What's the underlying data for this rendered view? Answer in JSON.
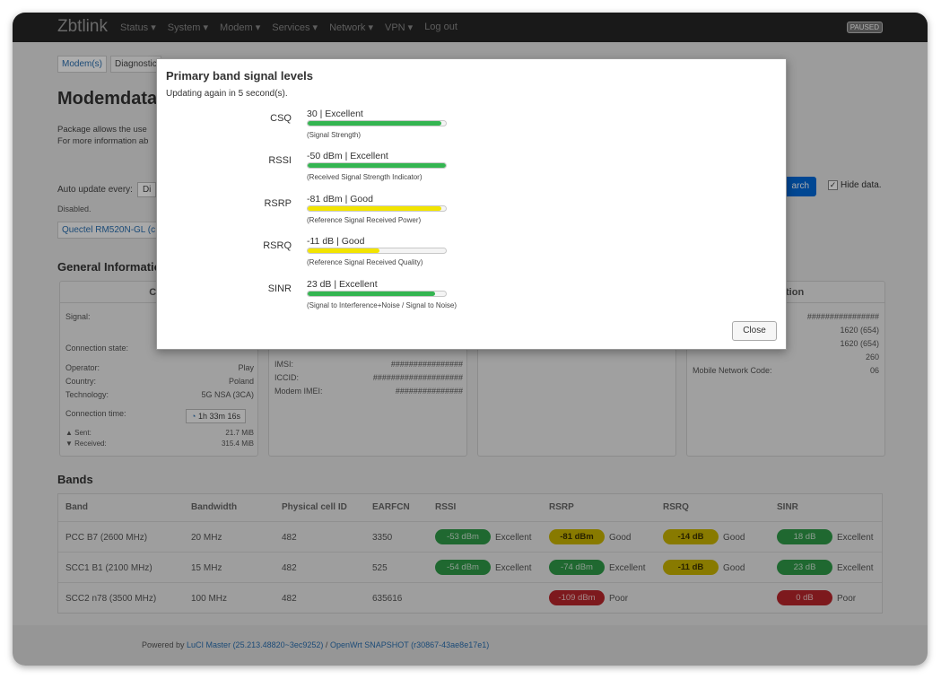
{
  "navbar": {
    "brand": "Zbtlink",
    "menu": [
      "Status ▾",
      "System ▾",
      "Modem ▾",
      "Services ▾",
      "Network ▾",
      "VPN ▾",
      "Log out"
    ],
    "badge": "PAUSED"
  },
  "page": {
    "tabs": [
      "Modem(s)",
      "Diagnostic"
    ],
    "title": "Modemdata",
    "desc_1": "Package allows the use",
    "desc_2": "For more information ab",
    "auto_update_label": "Auto update every:",
    "auto_update_value": "Di",
    "disabled": "Disabled.",
    "search_button": "arch",
    "hide_data": "Hide data.",
    "modem_tab": "Quectel RM520N-GL (c",
    "general_title": "General Informatio"
  },
  "cards": {
    "conn_header": "Con",
    "info_header": "rmation",
    "conn": {
      "signal_label": "Signal:",
      "state_label": "Connection state:",
      "operator_label": "Operator:",
      "operator": "Play",
      "country_label": "Country:",
      "country": "Poland",
      "tech_label": "Technology:",
      "tech": "5G NSA (3CA)",
      "time_label": "Connection time:",
      "time": "1h 33m 16s",
      "sent_label": "▲ Sent:",
      "sent": "21.7 MiB",
      "recv_label": "▼ Received:",
      "recv": "315.4 MiB"
    },
    "sim": {
      "imsi_label": "IMSI:",
      "imsi": "################",
      "iccid_label": "ICCID:",
      "iccid": "####################",
      "imei_label": "Modem IMEI:",
      "imei": "###############"
    },
    "cell": {
      "v1": "################",
      "v2": "1620 (654)",
      "v3": "1620 (654)",
      "v4": "260",
      "mnc_label": "Mobile Network Code:",
      "mnc": "06"
    }
  },
  "bands": {
    "title": "Bands",
    "headers": [
      "Band",
      "Bandwidth",
      "Physical cell ID",
      "EARFCN",
      "RSSI",
      "RSRP",
      "RSRQ",
      "SINR"
    ],
    "rows": [
      {
        "band": "PCC B7 (2600 MHz)",
        "bw": "20 MHz",
        "pci": "482",
        "earfcn": "3350",
        "rssi": "-53 dBm",
        "rssi_q": "Excellent",
        "rsrp": "-81 dBm",
        "rsrp_q": "Good",
        "rsrq": "-14 dB",
        "rsrq_q": "Good",
        "sinr": "18 dB",
        "sinr_q": "Excellent"
      },
      {
        "band": "SCC1 B1 (2100 MHz)",
        "bw": "15 MHz",
        "pci": "482",
        "earfcn": "525",
        "rssi": "-54 dBm",
        "rssi_q": "Excellent",
        "rsrp": "-74 dBm",
        "rsrp_q": "Excellent",
        "rsrq": "-11 dB",
        "rsrq_q": "Good",
        "sinr": "23 dB",
        "sinr_q": "Excellent"
      },
      {
        "band": "SCC2 n78 (3500 MHz)",
        "bw": "100 MHz",
        "pci": "482",
        "earfcn": "635616",
        "rssi": "",
        "rssi_q": "",
        "rsrp": "-109 dBm",
        "rsrp_q": "Poor",
        "rsrq": "",
        "rsrq_q": "",
        "sinr": "0 dB",
        "sinr_q": "Poor"
      }
    ]
  },
  "footer": {
    "prefix": "Powered by",
    "luci": "LuCI Master (25.213.48820~3ec9252)",
    "sep": "/",
    "openwrt": "OpenWrt SNAPSHOT (r30867-43ae8e17e1)"
  },
  "modal": {
    "title": "Primary band signal levels",
    "updating": "Updating again in 5 second(s).",
    "close": "Close",
    "signals": [
      {
        "label": "CSQ",
        "value": "30 | Excellent",
        "desc": "(Signal Strength)",
        "level": 0.97,
        "color": "#34b551"
      },
      {
        "label": "RSSI",
        "value": "-50 dBm | Excellent",
        "desc": "(Received Signal Strength Indicator)",
        "level": 1.0,
        "color": "#34b551"
      },
      {
        "label": "RSRP",
        "value": "-81 dBm | Good",
        "desc": "(Reference Signal Received Power)",
        "level": 0.97,
        "color": "#f2e400"
      },
      {
        "label": "RSRQ",
        "value": "-11 dB | Good",
        "desc": "(Reference Signal Received Quality)",
        "level": 0.52,
        "color": "#f2e400"
      },
      {
        "label": "SINR",
        "value": "23 dB | Excellent",
        "desc": "(Signal to Interference+Noise / Signal to Noise)",
        "level": 0.92,
        "color": "#34b551"
      }
    ]
  }
}
